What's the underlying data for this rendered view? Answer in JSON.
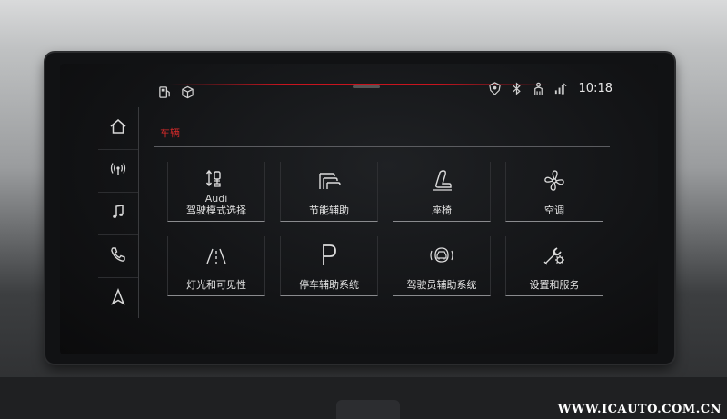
{
  "status_bar": {
    "left_icons": [
      "fuel-icon",
      "cube-icon"
    ],
    "right_icons": [
      "location-shield-icon",
      "bluetooth-icon",
      "person-icon",
      "signal-icon"
    ],
    "time": "10:18"
  },
  "sidebar": {
    "items": [
      {
        "name": "home",
        "icon": "home-icon"
      },
      {
        "name": "radio",
        "icon": "radio-icon"
      },
      {
        "name": "media",
        "icon": "music-note-icon"
      },
      {
        "name": "phone",
        "icon": "phone-icon"
      },
      {
        "name": "navigation",
        "icon": "navigation-icon"
      }
    ]
  },
  "breadcrumb": "车辆",
  "accent_color": "#c8141e",
  "tiles": [
    {
      "label": "驾驶模式选择",
      "brand": "Audi",
      "icon": "drive-select-icon"
    },
    {
      "label": "节能辅助",
      "icon": "efficiency-icon"
    },
    {
      "label": "座椅",
      "icon": "seat-icon"
    },
    {
      "label": "空调",
      "icon": "fan-icon"
    },
    {
      "label": "灯光和可见性",
      "icon": "lights-icon"
    },
    {
      "label": "停车辅助系统",
      "icon": "parking-icon"
    },
    {
      "label": "驾驶员辅助系统",
      "icon": "driver-assist-icon"
    },
    {
      "label": "设置和服务",
      "icon": "settings-icon"
    }
  ],
  "watermark": "WWW.ICAUTO.COM.CN"
}
